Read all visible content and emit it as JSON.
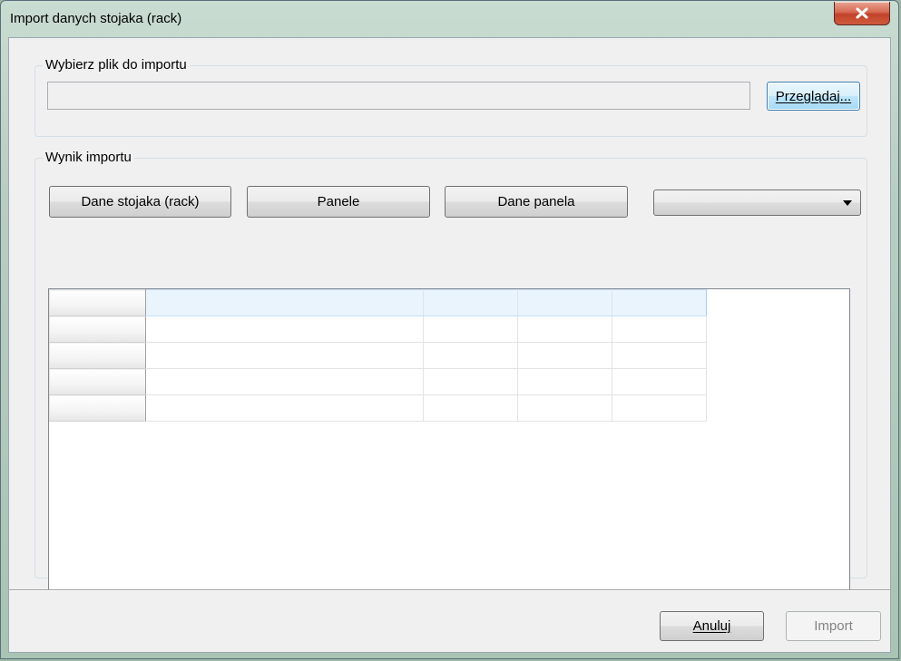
{
  "window": {
    "title": "Import danych stojaka (rack)"
  },
  "file_group": {
    "legend": "Wybierz plik do importu",
    "path_value": "",
    "browse_label": "Przeglądaj..."
  },
  "result_group": {
    "legend": "Wynik importu",
    "buttons": [
      "Dane stojaka (rack)",
      "Panele",
      "Dane panela"
    ],
    "combo_selected": ""
  },
  "grid": {
    "rows": [
      [
        "",
        "",
        "",
        ""
      ],
      [
        "",
        "",
        "",
        ""
      ],
      [
        "",
        "",
        "",
        ""
      ],
      [
        "",
        "",
        "",
        ""
      ],
      [
        "",
        "",
        "",
        ""
      ]
    ]
  },
  "footer": {
    "cancel_label": "Anuluj",
    "import_label": "Import"
  },
  "colors": {
    "close_button": "#c2432b",
    "focus_border": "#3c7fb1",
    "selection": "#eaf4fd"
  }
}
